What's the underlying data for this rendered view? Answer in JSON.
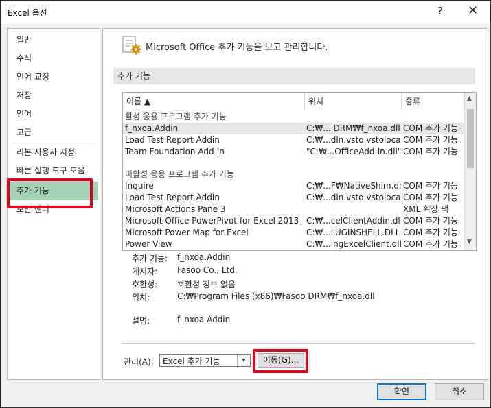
{
  "window": {
    "title": "Excel 옵션",
    "help_label": "?",
    "close_label": "✕"
  },
  "sidebar": {
    "items": [
      {
        "label": "일반"
      },
      {
        "label": "수식"
      },
      {
        "label": "언어 교정"
      },
      {
        "label": "저장"
      },
      {
        "label": "언어"
      },
      {
        "label": "고급"
      },
      {
        "label": "리본 사용자 지정"
      },
      {
        "label": "빠른 실행 도구 모음"
      },
      {
        "label": "추가 기능"
      },
      {
        "label": "보안 센터"
      }
    ],
    "selected": "추가 기능"
  },
  "main": {
    "header": "Microsoft Office 추가 기능을 보고 관리합니다.",
    "section_title": "추가 기능",
    "table": {
      "headers": {
        "name": "이름 ▲",
        "location": "위치",
        "type": "종류"
      },
      "rows": [
        {
          "group": "활성 응용 프로그램 추가 기능"
        },
        {
          "name": "f_nxoa.Addin",
          "location": "C:₩... DRM₩f_nxoa.dll",
          "type": "COM 추가 기능",
          "selected": true
        },
        {
          "name": "Load Test Report Addin",
          "location": "C:₩...dln.vsto|vstolocal",
          "type": "COM 추가 기능"
        },
        {
          "name": "Team Foundation Add-in",
          "location": "\"C:₩...OfficeAdd-in.dll\"",
          "type": "COM 추가 기능"
        },
        {
          "group": "비활성 응용 프로그램 추가 기능"
        },
        {
          "name": "Inquire",
          "location": "C:₩...F₩NativeShim.dll",
          "type": "COM 추가 기능"
        },
        {
          "name": "Load Test Report Addin",
          "location": "C:₩...dln.vsto|vstolocal",
          "type": "COM 추가 기능"
        },
        {
          "name": "Microsoft Actions Pane 3",
          "location": "",
          "type": "XML 확장 팩"
        },
        {
          "name": "Microsoft Office PowerPivot for Excel 2013",
          "location": "C:₩...celClientAddin.dll",
          "type": "COM 추가 기능"
        },
        {
          "name": "Microsoft Power Map for Excel",
          "location": "C:₩...LUGINSHELL.DLL",
          "type": "COM 추가 기능"
        },
        {
          "name": "Power View",
          "location": "C:₩...ingExcelClient.dll",
          "type": "COM 추가 기능"
        }
      ]
    },
    "details": {
      "addin_label": "추가 기능:",
      "addin_value": "f_nxoa.Addin",
      "publisher_label": "게시자:",
      "publisher_value": "Fasoo Co., Ltd.",
      "compat_label": "호환성:",
      "compat_value": "호환성 정보 없음",
      "location_label": "위치:",
      "location_value": "C:₩Program Files (x86)₩Fasoo DRM₩f_nxoa.dll",
      "desc_label": "설명:",
      "desc_value": "f_nxoa Addin"
    },
    "manage": {
      "label": "관리(A):",
      "selected": "Excel 추가 기능",
      "go_label": "이동(G)..."
    }
  },
  "footer": {
    "ok_label": "확인",
    "cancel_label": "취소"
  },
  "colors": {
    "selected_nav": "#a5d3b7",
    "highlight_box": "#e2001a",
    "accent": "#0078d7"
  },
  "icons": [
    "addin-gear-icon",
    "sort-ascending-icon",
    "chevron-down-icon",
    "scroll-up-icon",
    "scroll-down-icon",
    "close-icon"
  ]
}
